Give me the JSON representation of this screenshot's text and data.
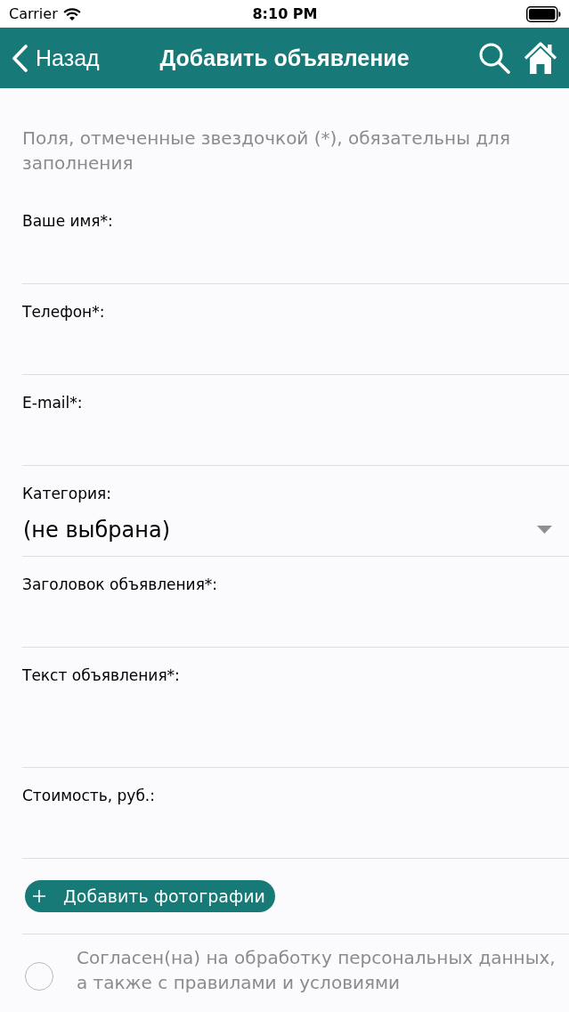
{
  "status_bar": {
    "carrier": "Carrier",
    "time": "8:10 PM"
  },
  "nav_bar": {
    "back_label": "Назад",
    "title": "Добавить объявление"
  },
  "form": {
    "hint": "Поля, отмеченные звездочкой (*), обязательны для заполнения",
    "fields": [
      {
        "kind": "text",
        "label": "Ваше имя*:"
      },
      {
        "kind": "text",
        "label": "Телефон*:"
      },
      {
        "kind": "text",
        "label": "E-mail*:"
      },
      {
        "kind": "select",
        "label": "Категория:",
        "value": "(не выбрана)"
      },
      {
        "kind": "text",
        "label": "Заголовок объявления*:"
      },
      {
        "kind": "textarea",
        "label": "Текст объявления*:"
      },
      {
        "kind": "text",
        "label": "Стоимость, руб.:"
      }
    ],
    "add_photos_button": {
      "label": "Добавить фотографии"
    },
    "consent": {
      "checked": false,
      "text": "Согласен(на) на обработку персональных данных, а также с правилами и условиями"
    }
  }
}
